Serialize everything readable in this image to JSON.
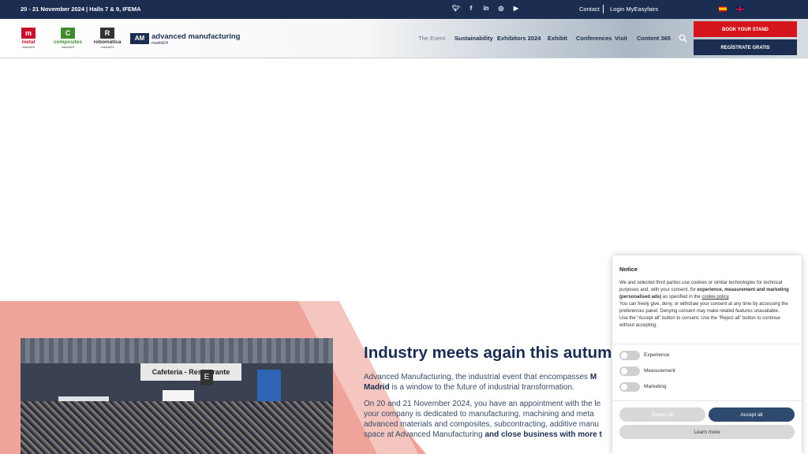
{
  "topbar": {
    "event_info": "20 - 21 November 2024 | Halls 7 & 9, IFEMA",
    "social_icons": [
      "twitter-icon",
      "facebook-icon",
      "linkedin-icon",
      "instagram-icon",
      "youtube-icon"
    ],
    "contact": "Contact",
    "login": "Login MyEasyfairs",
    "languages": [
      "es",
      "en"
    ]
  },
  "header": {
    "logos": {
      "metal": {
        "name": "metal",
        "sub": "madrid24"
      },
      "composites": {
        "name": "composites",
        "sub": "madrid24"
      },
      "robomatica": {
        "name": "robomática",
        "sub": "madrid24"
      },
      "am": {
        "name": "advanced manufacturing",
        "sub": "madrid24"
      }
    },
    "nav": [
      "The Event",
      "Sustainability",
      "Exhibitors 2024",
      "Exhibit",
      "Conferences",
      "Visit",
      "Content 365"
    ],
    "book_stand": "BOOK YOUR STAND",
    "register": "REGÍSTRATE GRATIS"
  },
  "hero": {
    "photo_sign": "Cafeteria - Restaurante",
    "title": "Industry meets again this autum",
    "p1_a": "Advanced Manufacturing, the industrial event that encompasses ",
    "p1_b": "M",
    "p1_c": "Madrid",
    "p1_d": " is a window to the future of industrial transformation.",
    "p2_a": "On 20 and 21 November 2024, you have an appointment with the le",
    "p2_b": "your company is dedicated to manufacturing, machining and meta",
    "p2_c": "advanced materials and composites, subcontracting, additive manu",
    "p2_d": "space at Advanced Manufacturing ",
    "p2_e": "and close business with more t"
  },
  "cookie": {
    "title": "Notice",
    "body_1": "We and selected third parties use cookies or similar technologies for technical purposes and, with your consent, for ",
    "body_bold": "experience, measurement and marketing (personalised ads)",
    "body_2": " as specified in the ",
    "body_link": "cookie policy",
    "body_3": ".",
    "body_4": "You can freely give, deny, or withdraw your consent at any time by accessing the preferences panel. Denying consent may make related features unavailable.",
    "body_5": "Use the “Accept all” button to consent. Use the “Reject all” button to continue without accepting.",
    "toggles": [
      "Experience",
      "Measurement",
      "Marketing"
    ],
    "reject": "Reject all",
    "accept": "Accept all",
    "learn": "Learn more"
  }
}
